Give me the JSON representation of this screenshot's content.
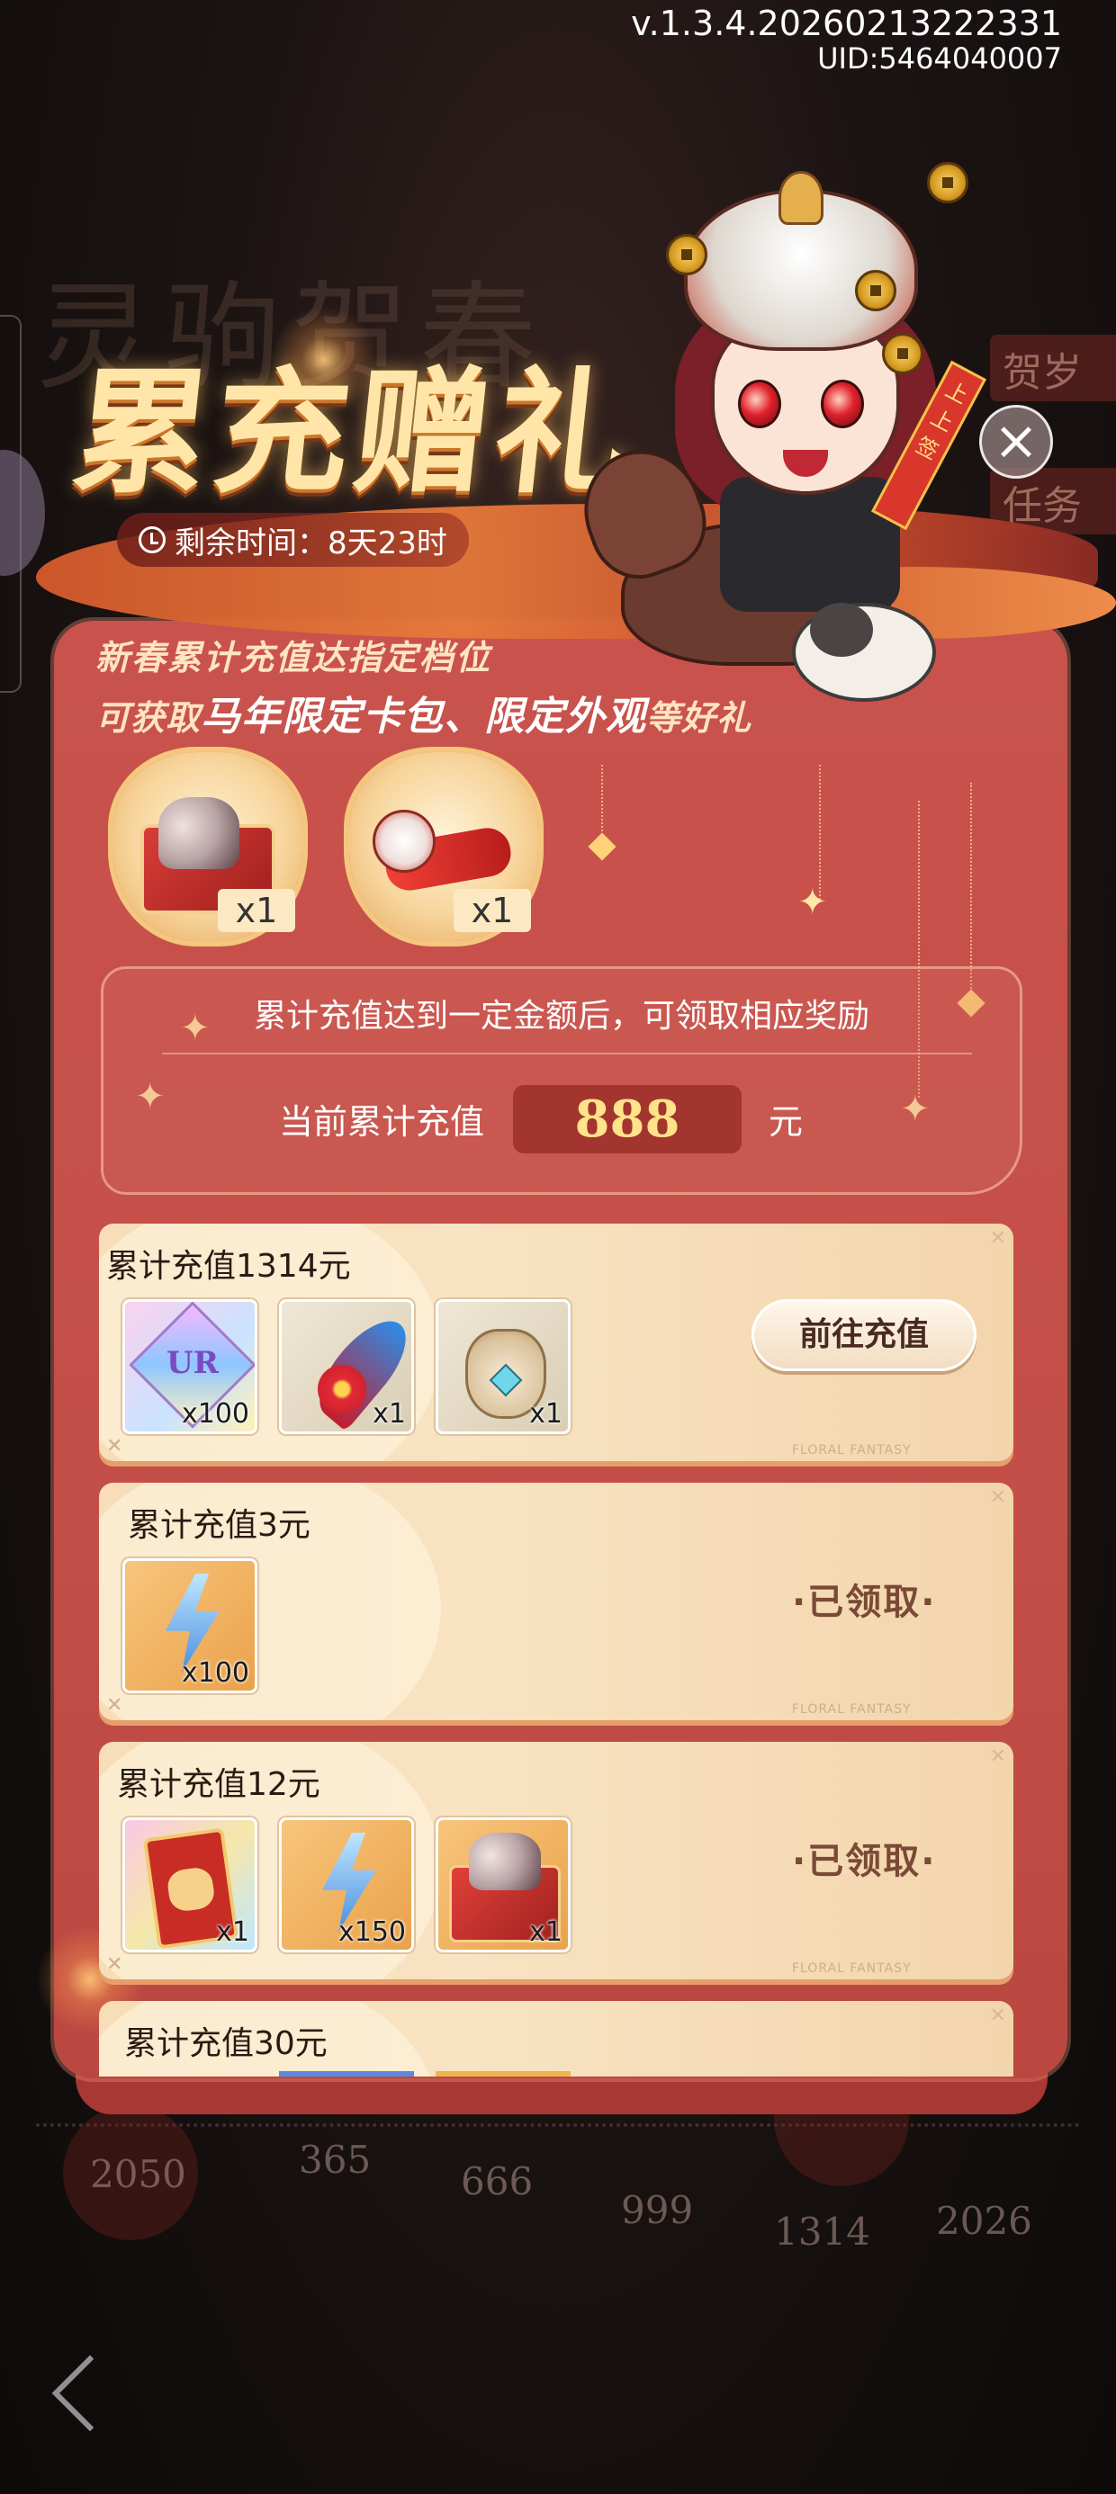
{
  "header": {
    "version": "v.1.3.4.20260213222331",
    "uid": "UID:5464040007"
  },
  "background": {
    "title_ghost": "灵驹贺春",
    "side_tabs": [
      "贺岁",
      "任务"
    ],
    "milestones": [
      "2050",
      "365",
      "666",
      "999",
      "1314",
      "2026"
    ]
  },
  "event": {
    "title": "累充赠礼",
    "timer_label": "剩余时间：8天23时",
    "scroll_text": "上上签",
    "intro_line1": "新春累计充值达指定档位",
    "intro_line2_prefix": "可获取",
    "intro_line2_highlight": "马年限定卡包、限定外观",
    "intro_line2_suffix": "等好礼"
  },
  "featured_rewards": [
    {
      "icon": "gift-box-figures-icon",
      "count": "x1"
    },
    {
      "icon": "lion-dance-red-item-icon",
      "count": "x1"
    }
  ],
  "summary": {
    "notice": "累计充值达到一定金额后，可领取相应奖励",
    "current_label": "当前累计充值",
    "current_amount": "888",
    "unit": "元"
  },
  "tiers": [
    {
      "label": "累计充值1314元",
      "items": [
        {
          "icon": "ur-gem-icon",
          "gem_text": "UR",
          "count": "x100"
        },
        {
          "icon": "feather-flower-icon",
          "count": "x1"
        },
        {
          "icon": "treasure-bag-icon",
          "count": "x1"
        }
      ],
      "action": "前往充值",
      "status": "claimable-go"
    },
    {
      "label": "累计充值3元",
      "items": [
        {
          "icon": "lightning-bolt-icon",
          "count": "x100"
        }
      ],
      "action": "·已领取·",
      "status": "claimed"
    },
    {
      "label": "累计充值12元",
      "items": [
        {
          "icon": "horse-card-pack-icon",
          "count": "x1"
        },
        {
          "icon": "lightning-bolt-icon",
          "count": "x150"
        },
        {
          "icon": "gift-box-figures-icon",
          "count": "x1"
        }
      ],
      "action": "·已领取·",
      "status": "claimed"
    },
    {
      "label": "累计充值30元"
    }
  ],
  "card_brand": "FLORAL FANTASY",
  "colors": {
    "panel": "#c9534c",
    "card": "#f7ddb8",
    "amount": "#ffe38a",
    "title": "#ffe6a8"
  }
}
